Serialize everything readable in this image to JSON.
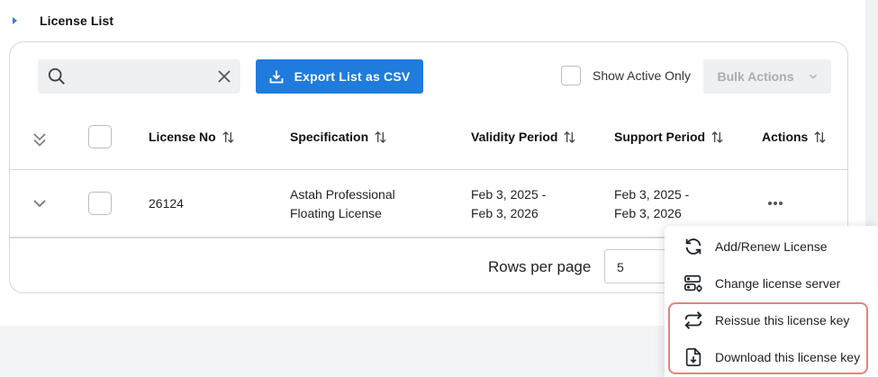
{
  "section": {
    "title": "License List"
  },
  "toolbar": {
    "search_value": "",
    "export_label": "Export List as CSV",
    "show_active_label": "Show Active Only",
    "bulk_actions_label": "Bulk Actions"
  },
  "table": {
    "columns": [
      "License No",
      "Specification",
      "Validity Period",
      "Support Period",
      "Actions"
    ],
    "rows": [
      {
        "license_no": "26124",
        "spec_line1": "Astah Professional",
        "spec_line2": "Floating License",
        "validity_line1": "Feb 3, 2025 -",
        "validity_line2": "Feb 3, 2026",
        "support_line1": "Feb 3, 2025 -",
        "support_line2": "Feb 3, 2026"
      }
    ]
  },
  "pagination": {
    "rows_per_page_label": "Rows per page",
    "rows_per_page_value": "5"
  },
  "menu": {
    "items": [
      {
        "label": "Add/Renew License",
        "icon": "refresh-icon"
      },
      {
        "label": "Change license server",
        "icon": "server-settings-icon"
      },
      {
        "label": "Reissue this license key",
        "icon": "repeat-icon"
      },
      {
        "label": "Download this license key",
        "icon": "download-file-icon"
      }
    ]
  },
  "colors": {
    "primary": "#1f7bdc",
    "highlight": "#e7827c"
  }
}
